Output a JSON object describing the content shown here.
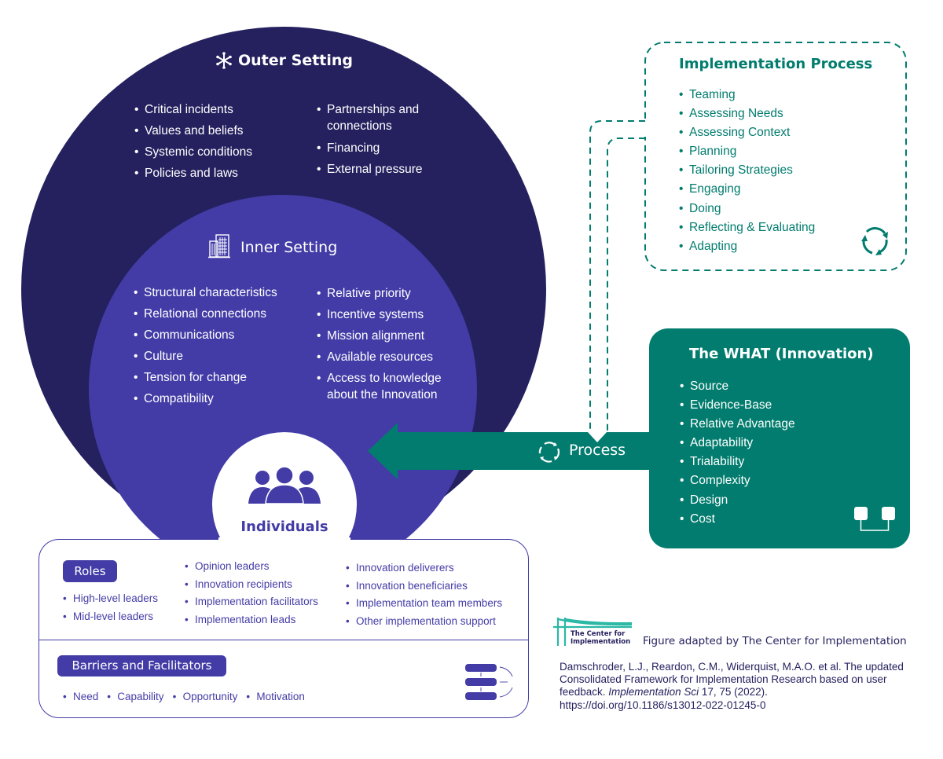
{
  "outer_setting": {
    "title": "Outer Setting",
    "icon": "asterisk-icon",
    "col1": [
      "Critical incidents",
      "Values and beliefs",
      "Systemic conditions",
      "Policies and laws"
    ],
    "col2": [
      "Partnerships and connections",
      "Financing",
      "External pressure"
    ]
  },
  "inner_setting": {
    "title": "Inner Setting",
    "icon": "buildings-icon",
    "col1": [
      "Structural characteristics",
      "Relational connections",
      "Communications",
      "Culture",
      "Tension for change",
      "Compatibility"
    ],
    "col2": [
      "Relative priority",
      "Incentive systems",
      "Mission alignment",
      "Available resources",
      "Access to knowledge about the Innovation"
    ]
  },
  "individuals": {
    "title": "Individuals",
    "icon": "people-group-icon",
    "roles_label": "Roles",
    "roles_col1": [
      "High-level leaders",
      "Mid-level leaders"
    ],
    "roles_col2": [
      "Opinion leaders",
      "Innovation recipients",
      "Implementation facilitators",
      "Implementation leads"
    ],
    "roles_col3": [
      "Innovation deliverers",
      "Innovation beneficiaries",
      "Implementation team members",
      "Other implementation support"
    ],
    "barriers_label": "Barriers and Facilitators",
    "barriers": [
      "Need",
      "Capability",
      "Opportunity",
      "Motivation"
    ]
  },
  "implementation_process": {
    "title": "Implementation Process",
    "icon": "cycle-arrows-icon",
    "items": [
      "Teaming",
      "Assessing Needs",
      "Assessing Context",
      "Planning",
      "Tailoring Strategies",
      "Engaging",
      "Doing",
      "Reflecting & Evaluating",
      "Adapting"
    ]
  },
  "innovation": {
    "title": "The WHAT (Innovation)",
    "icon": "connected-blocks-icon",
    "items": [
      "Source",
      "Evidence-Base",
      "Relative Advantage",
      "Adaptability",
      "Trialability",
      "Complexity",
      "Design",
      "Cost"
    ]
  },
  "process_arrow": {
    "label": "Process",
    "icon": "cycle-arrows-icon"
  },
  "footer": {
    "logo_text_line1": "The Center for",
    "logo_text_line2": "Implementation",
    "credit": "Figure adapted by The Center for Implementation",
    "citation_pre": "Damschroder, L.J., Reardon, C.M., Widerquist, M.A.O. et al. The updated Consolidated Framework for Implementation Research based on user feedback. ",
    "citation_journal": "Implementation Sci",
    "citation_post": " 17, 75 (2022).",
    "doi": "https://doi.org/10.1186/s13012-022-01245-0"
  },
  "colors": {
    "outer": "#25215f",
    "inner": "#433ca6",
    "teal": "#017c6e",
    "logo_teal": "#2bb8a5"
  }
}
